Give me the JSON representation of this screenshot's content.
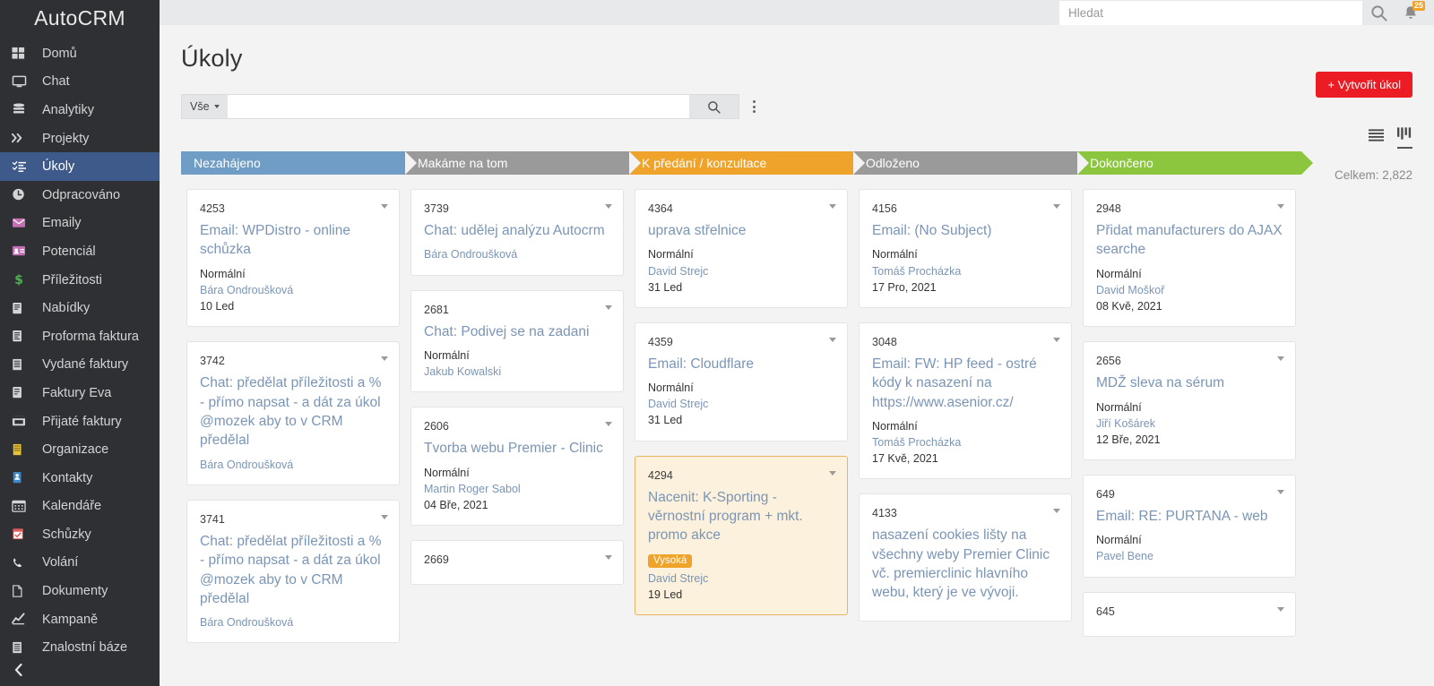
{
  "brand": "AutoCRM",
  "sidebar": {
    "items": [
      {
        "label": "Domů",
        "icon": "grid-icon",
        "active": false
      },
      {
        "label": "Chat",
        "icon": "monitor-icon",
        "active": false
      },
      {
        "label": "Analytiky",
        "icon": "database-icon",
        "active": false
      },
      {
        "label": "Projekty",
        "icon": "chevrons-right-icon",
        "active": false
      },
      {
        "label": "Úkoly",
        "icon": "task-list-icon",
        "active": true
      },
      {
        "label": "Odpracováno",
        "icon": "clock-icon",
        "active": false
      },
      {
        "label": "Emaily",
        "icon": "envelope-icon",
        "active": false
      },
      {
        "label": "Potenciál",
        "icon": "id-card-icon",
        "active": false
      },
      {
        "label": "Příležitosti",
        "icon": "dollar-icon",
        "active": false
      },
      {
        "label": "Nabídky",
        "icon": "quote-doc-icon",
        "active": false
      },
      {
        "label": "Proforma faktura",
        "icon": "proforma-doc-icon",
        "active": false
      },
      {
        "label": "Vydané faktury",
        "icon": "invoice-icon",
        "active": false
      },
      {
        "label": "Faktury Eva",
        "icon": "invoice-doc-icon",
        "active": false
      },
      {
        "label": "Přijaté faktury",
        "icon": "inbox-invoice-icon",
        "active": false
      },
      {
        "label": "Organizace",
        "icon": "building-icon",
        "active": false
      },
      {
        "label": "Kontakty",
        "icon": "contact-card-icon",
        "active": false
      },
      {
        "label": "Kalendáře",
        "icon": "calendar-icon",
        "active": false
      },
      {
        "label": "Schůzky",
        "icon": "calendar-check-icon",
        "active": false
      },
      {
        "label": "Volání",
        "icon": "phone-icon",
        "active": false
      },
      {
        "label": "Dokumenty",
        "icon": "document-icon",
        "active": false
      },
      {
        "label": "Kampaně",
        "icon": "chart-line-icon",
        "active": false
      },
      {
        "label": "Znalostní báze",
        "icon": "book-icon",
        "active": false
      }
    ],
    "collapse_icon": "chevron-left-icon"
  },
  "topbar": {
    "search_placeholder": "Hledat",
    "search_value": "",
    "search_icon": "search-icon",
    "bell_icon": "bell-icon",
    "bell_badge": "25"
  },
  "header": {
    "title": "Úkoly",
    "create_button": "Vytvořit úkol",
    "create_button_icon": "plus-icon",
    "create_button_color": "#ec1c24"
  },
  "toolbar": {
    "scope_label": "Vše",
    "search_value": "",
    "search_placeholder": "",
    "search_icon": "search-icon",
    "more_icon": "kebab-menu-icon",
    "view_list_icon": "list-view-icon",
    "view_kanban_icon": "kanban-view-icon",
    "total_label": "Celkem: 2,822"
  },
  "board": {
    "columns": [
      {
        "name": "Nezahájeno",
        "color": "#6f9dc6",
        "cards": [
          {
            "id": "4253",
            "title": "Email: WPDistro - online schůzka",
            "priority": "Normální",
            "priority_high": false,
            "user": "Bára Ondroušková",
            "date": "10 Led",
            "highlight": false
          },
          {
            "id": "3742",
            "title": "Chat: předělat příležitosti a % - přímo napsat - a dát za úkol @mozek aby to v CRM předělal",
            "priority": "",
            "priority_high": false,
            "user": "Bára Ondroušková",
            "date": "",
            "highlight": false
          },
          {
            "id": "3741",
            "title": "Chat: předělat příležitosti a % - přímo napsat - a dát za úkol @mozek aby to v CRM předělal",
            "priority": "",
            "priority_high": false,
            "user": "Bára Ondroušková",
            "date": "",
            "highlight": false
          }
        ]
      },
      {
        "name": "Makáme na tom",
        "color": "#9a9a9a",
        "cards": [
          {
            "id": "3739",
            "title": "Chat: udělej analýzu Autocrm",
            "priority": "",
            "priority_high": false,
            "user": "Bára Ondroušková",
            "date": "",
            "highlight": false
          },
          {
            "id": "2681",
            "title": "Chat: Podivej se na zadani",
            "priority": "Normální",
            "priority_high": false,
            "user": "Jakub Kowalski",
            "date": "",
            "highlight": false
          },
          {
            "id": "2606",
            "title": "Tvorba webu Premier - Clinic",
            "priority": "Normální",
            "priority_high": false,
            "user": "Martin Roger Sabol",
            "date": "04 Bře, 2021",
            "highlight": false
          },
          {
            "id": "2669",
            "title": "",
            "priority": "",
            "priority_high": false,
            "user": "",
            "date": "",
            "highlight": false
          }
        ]
      },
      {
        "name": "K předání / konzultace",
        "color": "#f0a32a",
        "cards": [
          {
            "id": "4364",
            "title": "uprava střelnice",
            "priority": "Normální",
            "priority_high": false,
            "user": "David Strejc",
            "date": "31 Led",
            "highlight": false
          },
          {
            "id": "4359",
            "title": "Email: Cloudflare",
            "priority": "Normální",
            "priority_high": false,
            "user": "David Strejc",
            "date": "31 Led",
            "highlight": false
          },
          {
            "id": "4294",
            "title": "Nacenit: K-Sporting - věrnostní program + mkt. promo akce",
            "priority": "Vysoká",
            "priority_high": true,
            "user": "David Strejc",
            "date": "19 Led",
            "highlight": true
          }
        ]
      },
      {
        "name": "Odloženo",
        "color": "#9a9a9a",
        "cards": [
          {
            "id": "4156",
            "title": "Email: (No Subject)",
            "priority": "Normální",
            "priority_high": false,
            "user": "Tomáš Procházka",
            "date": "17 Pro, 2021",
            "highlight": false
          },
          {
            "id": "3048",
            "title": "Email: FW: HP feed - ostré kódy k nasazení na https://www.asenior.cz/",
            "priority": "Normální",
            "priority_high": false,
            "user": "Tomáš Procházka",
            "date": "17 Kvě, 2021",
            "highlight": false
          },
          {
            "id": "4133",
            "title": "nasazení cookies lišty na všechny weby Premier Clinic vč. premierclinic hlavního webu, který je ve vývoji.",
            "priority": "",
            "priority_high": false,
            "user": "",
            "date": "",
            "highlight": false
          }
        ]
      },
      {
        "name": "Dokončeno",
        "color": "#8cc63f",
        "cards": [
          {
            "id": "2948",
            "title": "Přidat manufacturers do AJAX searche",
            "priority": "Normální",
            "priority_high": false,
            "user": "David Moškoř",
            "date": "08 Kvě, 2021",
            "highlight": false
          },
          {
            "id": "2656",
            "title": "MDŽ sleva na sérum",
            "priority": "Normální",
            "priority_high": false,
            "user": "Jiří Košárek",
            "date": "12 Bře, 2021",
            "highlight": false
          },
          {
            "id": "649",
            "title": "Email: RE: PURTANA - web",
            "priority": "Normální",
            "priority_high": false,
            "user": "Pavel Bene",
            "date": "",
            "highlight": false
          },
          {
            "id": "645",
            "title": "",
            "priority": "",
            "priority_high": false,
            "user": "",
            "date": "",
            "highlight": false
          }
        ]
      }
    ]
  }
}
